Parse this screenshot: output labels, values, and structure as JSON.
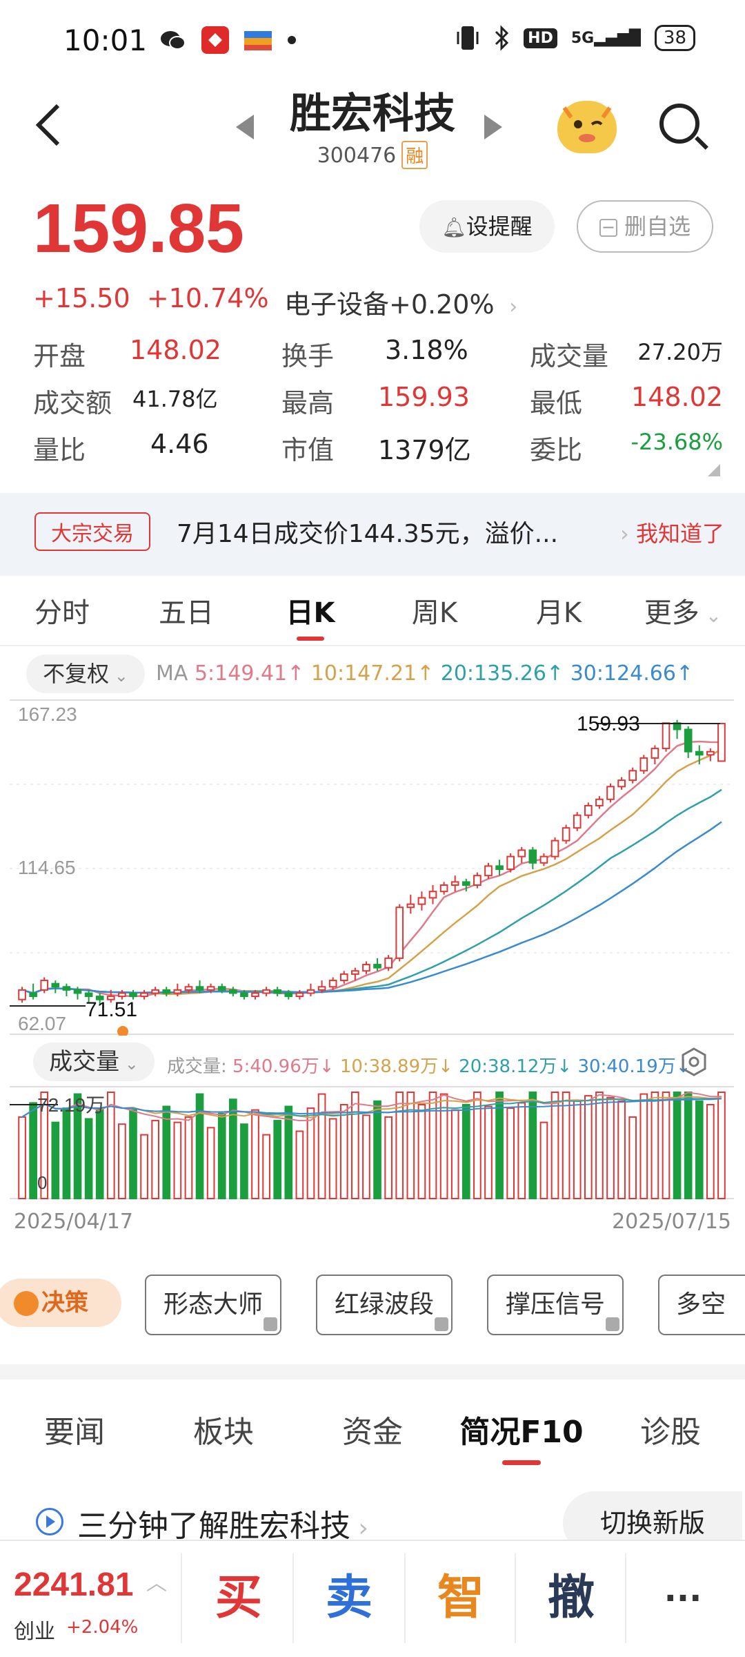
{
  "status_bar": {
    "time": "10:01",
    "network": "HD",
    "signal": "5G",
    "battery": "38"
  },
  "header": {
    "title": "胜宏科技",
    "code": "300476",
    "margin_badge": "融"
  },
  "quote": {
    "price": "159.85",
    "change": "+15.50",
    "change_pct": "+10.74%",
    "sector": "电子设备",
    "sector_pct": "+0.20%",
    "remind_label": "设提醒",
    "remove_watch_label": "删自选",
    "stats": [
      [
        {
          "label": "开盘",
          "value": "148.02",
          "color": "red"
        },
        {
          "label": "换手",
          "value": "3.18%",
          "color": "black"
        },
        {
          "label": "成交量",
          "value": "27.20万",
          "color": "black"
        }
      ],
      [
        {
          "label": "成交额",
          "value": "41.78亿",
          "color": "black"
        },
        {
          "label": "最高",
          "value": "159.93",
          "color": "red"
        },
        {
          "label": "最低",
          "value": "148.02",
          "color": "red"
        }
      ],
      [
        {
          "label": "量比",
          "value": "4.46",
          "color": "black"
        },
        {
          "label": "市值",
          "value": "1379亿",
          "color": "black"
        },
        {
          "label": "委比",
          "value": "-23.68%",
          "color": "green"
        }
      ]
    ]
  },
  "banner": {
    "tag": "大宗交易",
    "text": "7月14日成交价144.35元，溢价...",
    "action": "我知道了"
  },
  "period_tabs": [
    "分时",
    "五日",
    "日K",
    "周K",
    "月K",
    "更多"
  ],
  "active_period": "日K",
  "adjust_label": "不复权",
  "ma": {
    "label": "MA",
    "ma5": "5:149.41↑",
    "ma10": "10:147.21↑",
    "ma20": "20:135.26↑",
    "ma30": "30:124.66↑"
  },
  "kline_labels": {
    "top": "167.23",
    "mid": "114.65",
    "bottom": "62.07",
    "high_marker": "159.93",
    "low_marker": "71.51"
  },
  "volume": {
    "label": "成交量",
    "prefix": "成交量:",
    "ma5": "5:40.96万↓",
    "ma10": "10:38.89万↓",
    "ma20": "20:38.12万↓",
    "ma30": "30:40.19万↓",
    "max_label": "72.19万",
    "zero_label": "0"
  },
  "dates": {
    "start": "2025/04/17",
    "end": "2025/07/15"
  },
  "tools": {
    "decision": "决策",
    "buttons": [
      "形态大师",
      "红绿波段",
      "撑压信号",
      "多空"
    ]
  },
  "news_tabs": [
    "要闻",
    "板块",
    "资金",
    "简况F10",
    "诊股"
  ],
  "active_news_tab": "简况F10",
  "intro": {
    "text": "三分钟了解胜宏科技",
    "switch_label": "切换新版"
  },
  "bottom_bar": {
    "index_value": "2241.81",
    "index_name": "创业",
    "index_change": "+2.04%",
    "buy": "买",
    "sell": "卖",
    "smart": "智",
    "cancel": "撤",
    "more": "···"
  },
  "colors": {
    "up": "#e03636",
    "down": "#1a9e3e",
    "ma5": "#e07a8a",
    "ma10": "#d4a24a",
    "ma20": "#2fa0a8",
    "ma30": "#3a8ad0"
  },
  "chart_data": {
    "type": "candlestick",
    "ylim": [
      62.07,
      167.23
    ],
    "candles": [
      [
        73,
        76,
        72,
        77
      ],
      [
        75,
        74,
        73,
        78
      ],
      [
        76,
        79,
        75,
        80
      ],
      [
        78,
        77,
        75,
        79
      ],
      [
        77,
        76,
        74,
        78
      ],
      [
        76,
        75,
        73,
        77
      ],
      [
        75,
        74,
        72,
        76
      ],
      [
        74,
        73,
        71.51,
        75
      ],
      [
        73,
        74,
        72,
        76
      ],
      [
        74,
        75,
        73,
        76
      ],
      [
        75,
        74,
        73,
        76
      ],
      [
        74,
        75,
        73,
        76
      ],
      [
        75,
        76,
        74,
        77
      ],
      [
        76,
        75,
        74,
        77
      ],
      [
        75,
        76,
        74,
        78
      ],
      [
        76,
        77,
        75,
        78
      ],
      [
        77,
        76,
        75,
        79
      ],
      [
        76,
        77,
        75,
        78
      ],
      [
        77,
        76,
        75,
        78
      ],
      [
        76,
        75,
        74,
        77
      ],
      [
        75,
        74,
        73,
        76
      ],
      [
        74,
        75,
        73,
        76
      ],
      [
        75,
        76,
        74,
        77
      ],
      [
        76,
        75,
        74,
        77
      ],
      [
        75,
        74,
        73,
        76
      ],
      [
        74,
        75,
        73,
        76
      ],
      [
        75,
        76,
        74,
        78
      ],
      [
        76,
        77,
        75,
        79
      ],
      [
        77,
        79,
        76,
        80
      ],
      [
        79,
        81,
        78,
        82
      ],
      [
        81,
        82,
        79,
        83
      ],
      [
        82,
        84,
        81,
        85
      ],
      [
        84,
        83,
        82,
        86
      ],
      [
        83,
        86,
        82,
        87
      ],
      [
        86,
        102,
        85,
        103
      ],
      [
        102,
        103,
        100,
        106
      ],
      [
        103,
        105,
        101,
        107
      ],
      [
        105,
        107,
        103,
        109
      ],
      [
        107,
        109,
        106,
        110
      ],
      [
        109,
        110,
        107,
        112
      ],
      [
        110,
        109,
        107,
        111
      ],
      [
        109,
        112,
        108,
        113
      ],
      [
        112,
        115,
        111,
        116
      ],
      [
        115,
        114,
        112,
        117
      ],
      [
        114,
        118,
        113,
        119
      ],
      [
        118,
        120,
        116,
        121
      ],
      [
        120,
        116,
        114,
        121
      ],
      [
        116,
        118,
        115,
        119
      ],
      [
        118,
        123,
        117,
        124
      ],
      [
        123,
        127,
        122,
        128
      ],
      [
        127,
        131,
        126,
        132
      ],
      [
        131,
        134,
        130,
        135
      ],
      [
        134,
        136,
        133,
        137
      ],
      [
        136,
        140,
        135,
        141
      ],
      [
        140,
        142,
        139,
        143
      ],
      [
        142,
        145,
        141,
        146
      ],
      [
        145,
        149,
        144,
        150
      ],
      [
        149,
        152,
        147,
        153
      ],
      [
        152,
        160,
        151,
        160
      ],
      [
        160,
        158,
        155,
        161
      ],
      [
        158,
        151,
        149,
        159
      ],
      [
        151,
        150,
        147,
        153
      ],
      [
        150,
        151,
        148,
        152
      ],
      [
        148.02,
        159.85,
        148.02,
        159.93
      ]
    ]
  }
}
